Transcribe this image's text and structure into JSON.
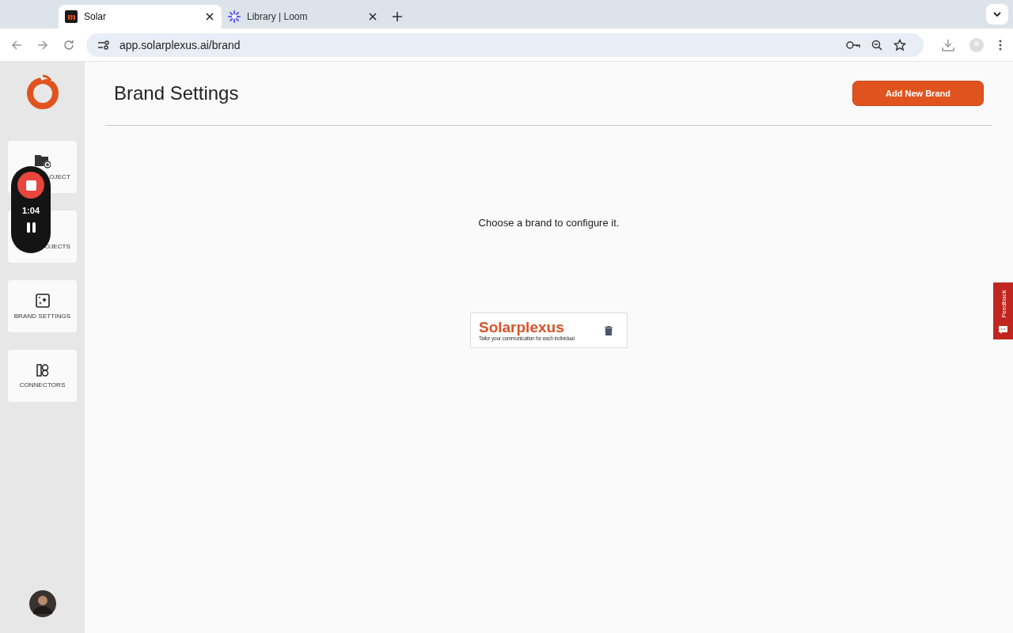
{
  "browser": {
    "tabs": [
      {
        "title": "Solar",
        "selected": true
      },
      {
        "title": "Library | Loom",
        "selected": false
      }
    ],
    "url": "app.solarplexus.ai/brand"
  },
  "sidebar": {
    "items": [
      {
        "label": "OJECT",
        "kind": "new-project"
      },
      {
        "label": "OJECTS",
        "kind": "projects"
      },
      {
        "label": "BRAND SETTINGS",
        "kind": "brand"
      },
      {
        "label": "CONNECTORS",
        "kind": "connectors"
      }
    ]
  },
  "recorder": {
    "time": "1:04"
  },
  "page": {
    "title": "Brand Settings",
    "add_button": "Add New Brand",
    "hint": "Choose a brand to configure it.",
    "brands": [
      {
        "name": "Solarplexus",
        "tagline": "Tailor your communication for each individual"
      }
    ]
  },
  "feedback": "Feedback"
}
